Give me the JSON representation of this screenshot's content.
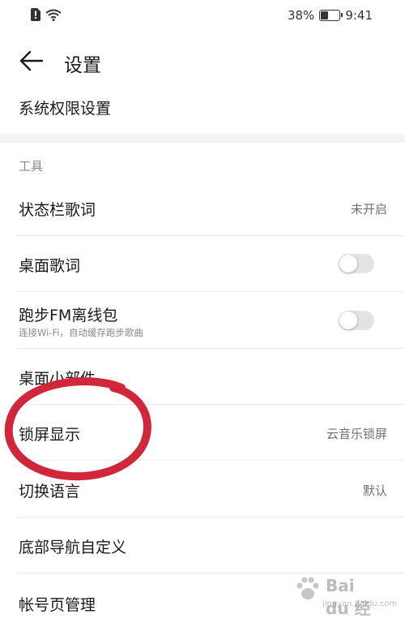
{
  "status_bar": {
    "battery_percent_text": "38%",
    "battery_level": 0.38,
    "time": "9:41",
    "icons": [
      "alert-sim-icon",
      "wifi-icon",
      "battery-icon"
    ]
  },
  "header": {
    "back_icon": "arrow-left-icon",
    "title": "设置"
  },
  "top_item": {
    "label": "系统权限设置"
  },
  "tools_section": {
    "title": "工具",
    "items": [
      {
        "label": "状态栏歌词",
        "value": "未开启"
      },
      {
        "label": "桌面歌词",
        "toggle": false
      },
      {
        "label": "跑步FM离线包",
        "sublabel": "连接Wi-Fi，自动缓存跑步歌曲",
        "toggle": false
      },
      {
        "label": "桌面小部件"
      },
      {
        "label": "锁屏显示",
        "value": "云音乐锁屏"
      },
      {
        "label": "切换语言",
        "value": "默认"
      },
      {
        "label": "底部导航自定义"
      },
      {
        "label": "帐号页管理"
      }
    ]
  },
  "annotation_color": "#d0283a",
  "watermark": {
    "text": "Bai du 经验",
    "sub": "jingyan.baidu.com"
  }
}
